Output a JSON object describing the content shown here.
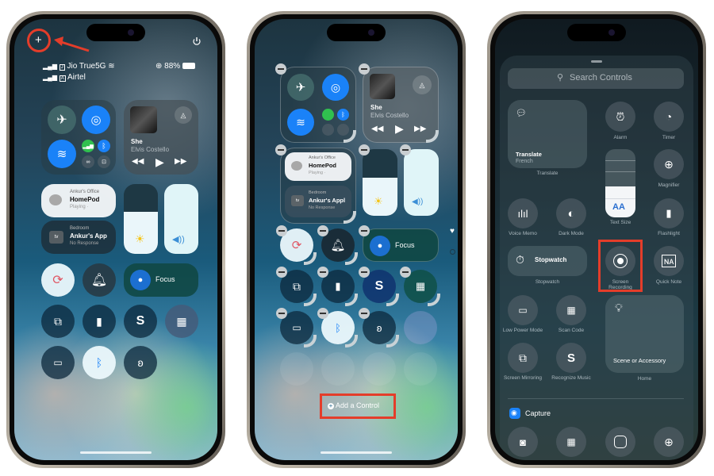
{
  "phone1": {
    "add_button": "+",
    "status": {
      "carrier1": "Jio True5G",
      "carrier1_sim": "J",
      "carrier2": "Airtel",
      "carrier2_sim": "A",
      "battery": "88%"
    },
    "now_playing": {
      "title": "She",
      "artist": "Elvis Costello"
    },
    "homepod": {
      "room": "Ankur's Office",
      "name": "HomePod",
      "status": "Playing ·"
    },
    "appletv": {
      "room": "Bedroom",
      "name": "Ankur's App",
      "status": "No Response",
      "badge": "tv"
    },
    "focus_label": "Focus",
    "brightness_level": 0.6,
    "volume_level": 1.0
  },
  "phone2": {
    "now_playing": {
      "title": "She",
      "artist": "Elvis Costello"
    },
    "homepod": {
      "room": "Ankur's Office",
      "name": "HomePod",
      "status": "Playing ·"
    },
    "appletv": {
      "room": "Bedroom",
      "name": "Ankur's Appl",
      "status": "No Response",
      "badge": "tv"
    },
    "focus_label": "Focus",
    "add_control": "Add a Control"
  },
  "phone3": {
    "search_placeholder": "Search Controls",
    "translate": {
      "title": "Translate",
      "subtitle": "French",
      "label": "Translate"
    },
    "controls": {
      "alarm": "Alarm",
      "timer": "Timer",
      "magnifier": "Magnifier",
      "voice_memo": "Voice Memo",
      "dark_mode": "Dark Mode",
      "text_size": "Text Size",
      "text_size_glyph": "AA",
      "flashlight": "Flashlight",
      "stopwatch_title": "Stopwatch",
      "stopwatch": "Stopwatch",
      "screen_recording": "Screen Recording",
      "quick_note": "Quick Note",
      "low_power": "Low Power Mode",
      "scan_code": "Scan Code",
      "scene_title": "Scene or Accessory",
      "home": "Home",
      "screen_mirroring": "Screen Mirroring",
      "recognize_music": "Recognize Music"
    },
    "section_capture": "Capture"
  },
  "colors": {
    "accent_blue": "#1a82f8",
    "highlight_red": "#e43d2a",
    "cellular_green": "#30c04f"
  }
}
